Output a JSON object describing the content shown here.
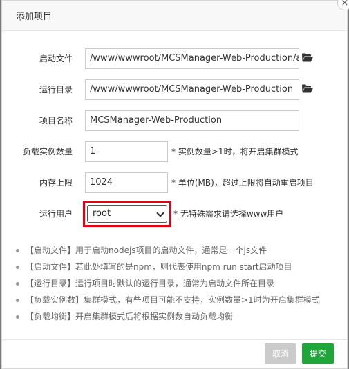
{
  "dialog": {
    "title": "添加项目",
    "close_symbol": "×"
  },
  "form": {
    "startup_file": {
      "label": "启动文件",
      "value": "/www/wwwroot/MCSManager-Web-Production/app.js",
      "icon": "folder-open-icon"
    },
    "run_dir": {
      "label": "运行目录",
      "value": "/www/wwwroot/MCSManager-Web-Production",
      "icon": "folder-open-icon"
    },
    "project_name": {
      "label": "项目名称",
      "value": "MCSManager-Web-Production"
    },
    "instances": {
      "label": "负载实例数量",
      "value": "1",
      "hint": "* 实例数量>1时，将开启集群模式"
    },
    "memory": {
      "label": "内存上限",
      "value": "1024",
      "hint": "* 单位(MB)，超过上限将自动重启项目"
    },
    "run_user": {
      "label": "运行用户",
      "selected": "root",
      "hint": "* 无特殊需求请选择www用户",
      "highlight_color": "#e60012"
    }
  },
  "notes": [
    "【启动文件】用于启动nodejs项目的启动文件，通常是一个js文件",
    "【启动文件】若此处填写的是npm，则代表使用npm run start启动项目",
    "【运行目录】运行项目时默认的运行目录，通常为启动文件所在目录",
    "【负载实例数】集群模式，有些项目可能不支持，实例数量>1时为开启集群模式",
    "【负载均衡】开启集群模式后将根据实例数自动负载均衡"
  ],
  "footer": {
    "cancel_label": "取消",
    "submit_label": "提交",
    "submit_color": "#20a53a"
  }
}
